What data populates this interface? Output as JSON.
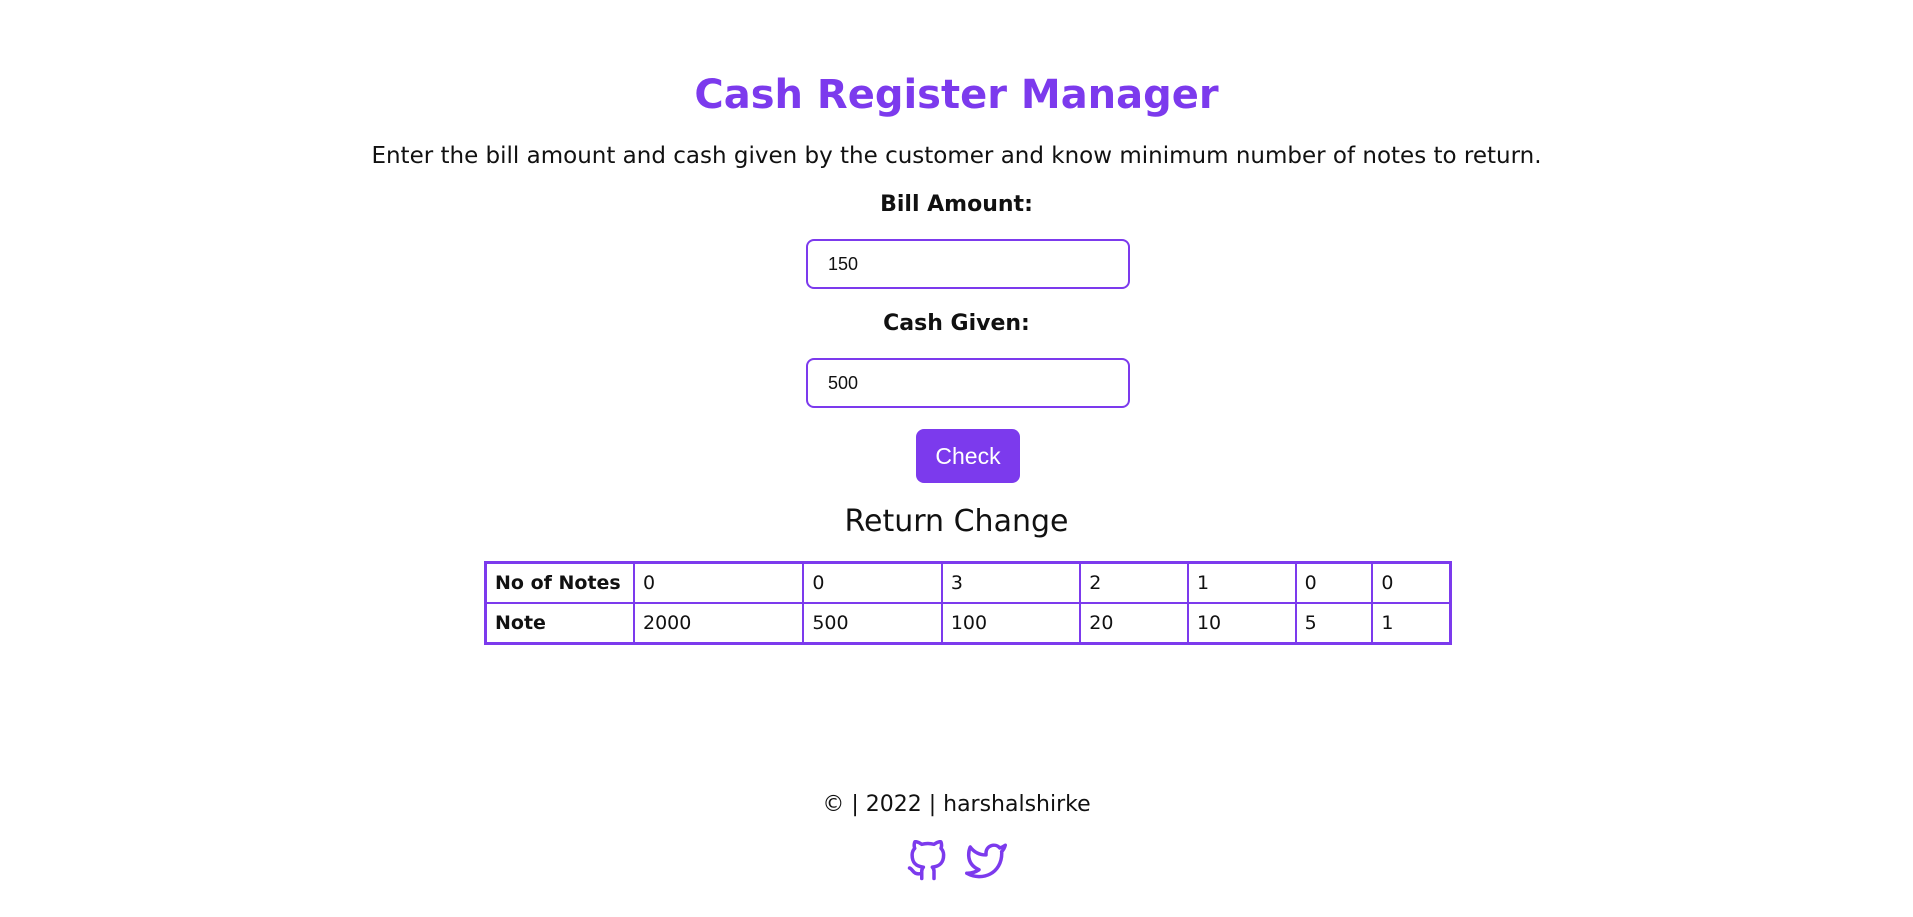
{
  "header": {
    "title": "Cash Register Manager",
    "subtitle": "Enter the bill amount and cash given by the customer and know minimum number of notes to return."
  },
  "form": {
    "bill_label": "Bill Amount:",
    "bill_value": "150",
    "cash_label": "Cash Given:",
    "cash_value": "500",
    "check_label": "Check"
  },
  "result": {
    "title": "Return Change",
    "notes_header": "No of Notes",
    "note_header": "Note",
    "counts": [
      "0",
      "0",
      "3",
      "2",
      "1",
      "0",
      "0"
    ],
    "notes": [
      "2000",
      "500",
      "100",
      "20",
      "10",
      "5",
      "1"
    ]
  },
  "footer": {
    "text": "© | 2022 | harshalshirke",
    "icons": [
      "github-icon",
      "twitter-icon"
    ]
  },
  "colors": {
    "accent": "#7c3aed",
    "text": "#111111"
  }
}
